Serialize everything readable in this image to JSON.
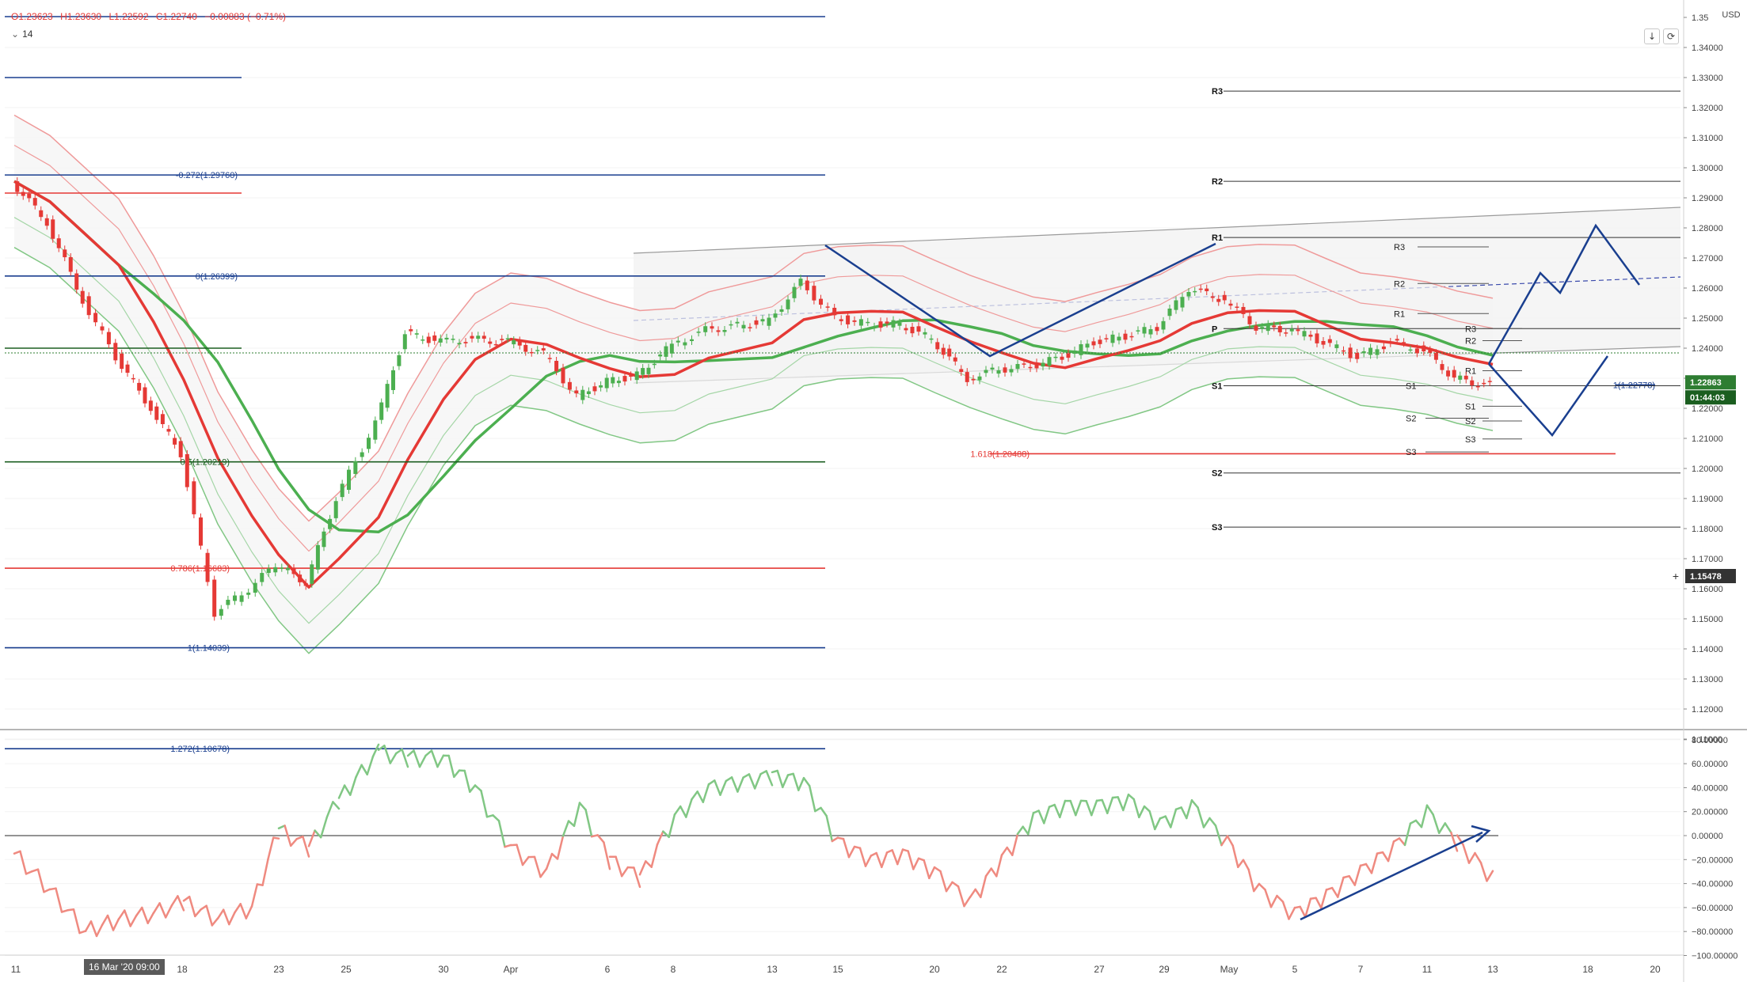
{
  "legend": {
    "open": "O1.23623",
    "high": "H1.23630",
    "low": "L1.22592",
    "close": "C1.22740",
    "change": "−0.00883 (−0.71%)",
    "period": "14"
  },
  "controls": {
    "download_icon": "arrow-down-icon",
    "refresh_icon": "refresh-icon",
    "settings_icon": "gear-icon",
    "currency": "USD"
  },
  "crosshair_date": "16 Mar '20   09:00",
  "price_tags": {
    "last": "1.22863",
    "countdown": "01:44:03",
    "cursor": "1.15478"
  },
  "colors": {
    "bull": "#4caf50",
    "bear": "#e53935",
    "fib": "#1a3f8f",
    "channel": "#9a9a9a",
    "ma_fast": "#e53935",
    "ma_slow": "#4caf50"
  },
  "chart_data": [
    {
      "type": "line",
      "panel": "price",
      "ylim": [
        1.1,
        1.35
      ],
      "y_ticks": [
        "1.35",
        "1.34000",
        "1.33000",
        "1.32000",
        "1.31000",
        "1.30000",
        "1.29000",
        "1.28000",
        "1.27000",
        "1.26000",
        "1.25000",
        "1.24000",
        "1.23000",
        "1.22000",
        "1.21000",
        "1.20000",
        "1.19000",
        "1.18000",
        "1.17000",
        "1.16000",
        "1.15000",
        "1.14000",
        "1.13000",
        "1.12000",
        "1.11000"
      ],
      "x_ticks": [
        "11",
        "16 Mar '20   09:00",
        "18",
        "23",
        "25",
        "30",
        "Apr",
        "6",
        "8",
        "13",
        "15",
        "20",
        "22",
        "27",
        "29",
        "May",
        "5",
        "7",
        "11",
        "13",
        "18",
        "20"
      ],
      "series": [
        {
          "x": [
            "11",
            "12",
            "13",
            "16",
            "17",
            "18",
            "19",
            "20",
            "23",
            "24",
            "25",
            "26",
            "27",
            "30",
            "31",
            "Apr",
            "2",
            "3",
            "6",
            "7",
            "8",
            "9",
            "13",
            "14",
            "15",
            "16",
            "17",
            "20",
            "21",
            "22",
            "23",
            "24",
            "27",
            "28",
            "29",
            "30",
            "May",
            "4",
            "5",
            "6",
            "7",
            "8",
            "11",
            "12",
            "13"
          ],
          "values": [
            1.2955,
            1.282,
            1.256,
            1.237,
            1.22,
            1.205,
            1.152,
            1.16,
            1.168,
            1.162,
            1.19,
            1.215,
            1.245,
            1.242,
            1.243,
            1.242,
            1.238,
            1.224,
            1.229,
            1.231,
            1.241,
            1.246,
            1.249,
            1.262,
            1.25,
            1.248,
            1.248,
            1.243,
            1.23,
            1.233,
            1.234,
            1.237,
            1.242,
            1.244,
            1.247,
            1.26,
            1.256,
            1.247,
            1.246,
            1.242,
            1.237,
            1.242,
            1.239,
            1.23,
            1.2274
          ]
        }
      ],
      "fibonacci": [
        {
          "label": "-0.272(1.29760)",
          "value": 1.2976
        },
        {
          "label": "0(1.26399)",
          "value": 1.26399
        },
        {
          "label": "0.5(1.20219)",
          "value": 1.20219
        },
        {
          "label": "0.786(1.16683)",
          "value": 1.16683
        },
        {
          "label": "1(1.14039)",
          "value": 1.14039
        },
        {
          "label": "1.272(1.10678)",
          "value": 1.10678
        },
        {
          "label": "1.618(1.20488)",
          "value": 1.20488
        },
        {
          "label": "1(1.22778)",
          "value": 1.22778
        }
      ],
      "pivots_major": [
        {
          "label": "R3",
          "value": 1.3255
        },
        {
          "label": "R2",
          "value": 1.2955
        },
        {
          "label": "R1",
          "value": 1.2768
        },
        {
          "label": "P",
          "value": 1.2465
        },
        {
          "label": "S1",
          "value": 1.2275
        },
        {
          "label": "S2",
          "value": 1.1985
        },
        {
          "label": "S3",
          "value": 1.1805
        }
      ],
      "pivots_minor": [
        {
          "label": "R3",
          "value": 1.2737
        },
        {
          "label": "R2",
          "value": 1.2615
        },
        {
          "label": "R1",
          "value": 1.2515
        },
        {
          "label": "R3",
          "value": 1.2465
        },
        {
          "label": "R2",
          "value": 1.2425
        },
        {
          "label": "R1",
          "value": 1.2325
        },
        {
          "label": "S1",
          "value": 1.2275
        },
        {
          "label": "S1",
          "value": 1.2207
        },
        {
          "label": "S2",
          "value": 1.2167
        },
        {
          "label": "S2",
          "value": 1.2158
        },
        {
          "label": "S3",
          "value": 1.2098
        },
        {
          "label": "S3",
          "value": 1.2055
        }
      ]
    },
    {
      "type": "line",
      "panel": "oscillator",
      "ylim": [
        -100,
        85
      ],
      "y_ticks": [
        "80.00000",
        "60.00000",
        "40.00000",
        "20.00000",
        "0.00000",
        "−20.00000",
        "−40.00000",
        "−60.00000",
        "−80.00000",
        "−100.00000"
      ],
      "series": [
        {
          "x": [
            "11",
            "12",
            "13",
            "16",
            "17",
            "18",
            "19",
            "20",
            "23",
            "24",
            "25",
            "26",
            "27",
            "30",
            "31",
            "Apr",
            "2",
            "3",
            "6",
            "7",
            "8",
            "9",
            "13",
            "14",
            "15",
            "16",
            "17",
            "20",
            "21",
            "22",
            "23",
            "24",
            "27",
            "28",
            "29",
            "30",
            "May",
            "4",
            "5",
            "6",
            "7",
            "8",
            "11",
            "12",
            "13"
          ],
          "values": [
            -15,
            -45,
            -80,
            -70,
            -65,
            -55,
            -70,
            -60,
            5,
            -10,
            30,
            70,
            65,
            65,
            40,
            -10,
            -30,
            25,
            -20,
            -35,
            15,
            40,
            50,
            45,
            -5,
            -20,
            -15,
            -30,
            -55,
            -20,
            15,
            25,
            25,
            30,
            10,
            25,
            -5,
            -45,
            -65,
            -50,
            -30,
            -10,
            20,
            -5,
            -35
          ]
        }
      ]
    }
  ]
}
